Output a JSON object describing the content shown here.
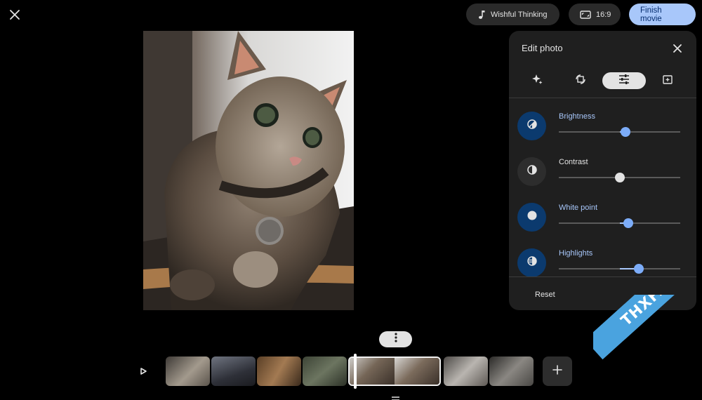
{
  "top_bar": {
    "close_icon": "close-icon",
    "music_label": "Wishful Thinking",
    "music_icon": "music-note-icon",
    "aspect_label": "16:9",
    "aspect_icon": "aspect-ratio-icon",
    "finish_label": "Finish movie"
  },
  "edit_panel": {
    "title": "Edit photo",
    "tools": [
      {
        "icon": "sparkle-icon"
      },
      {
        "icon": "crop-rotate-icon"
      },
      {
        "icon": "tune-icon"
      },
      {
        "icon": "filter-icon"
      }
    ],
    "adjustments": [
      {
        "label": "Brightness",
        "value": 0.55,
        "active": true,
        "icon": "brightness-icon"
      },
      {
        "label": "Contrast",
        "value": 0.5,
        "active": false,
        "icon": "contrast-icon"
      },
      {
        "label": "White point",
        "value": 0.57,
        "active": true,
        "icon": "white-point-icon"
      },
      {
        "label": "Highlights",
        "value": 0.66,
        "active": true,
        "icon": "highlights-icon"
      }
    ],
    "reset_label": "Reset"
  },
  "timeline": {
    "more_icon": "more-vertical-icon",
    "play_icon": "play-icon",
    "add_icon": "add-icon",
    "handle_icon": "drag-handle-icon"
  },
  "watermark": {
    "text": "THXF.ORG"
  },
  "colors": {
    "accent": "#a8c7fa",
    "panel": "#1f1f1f",
    "background": "#000000"
  }
}
